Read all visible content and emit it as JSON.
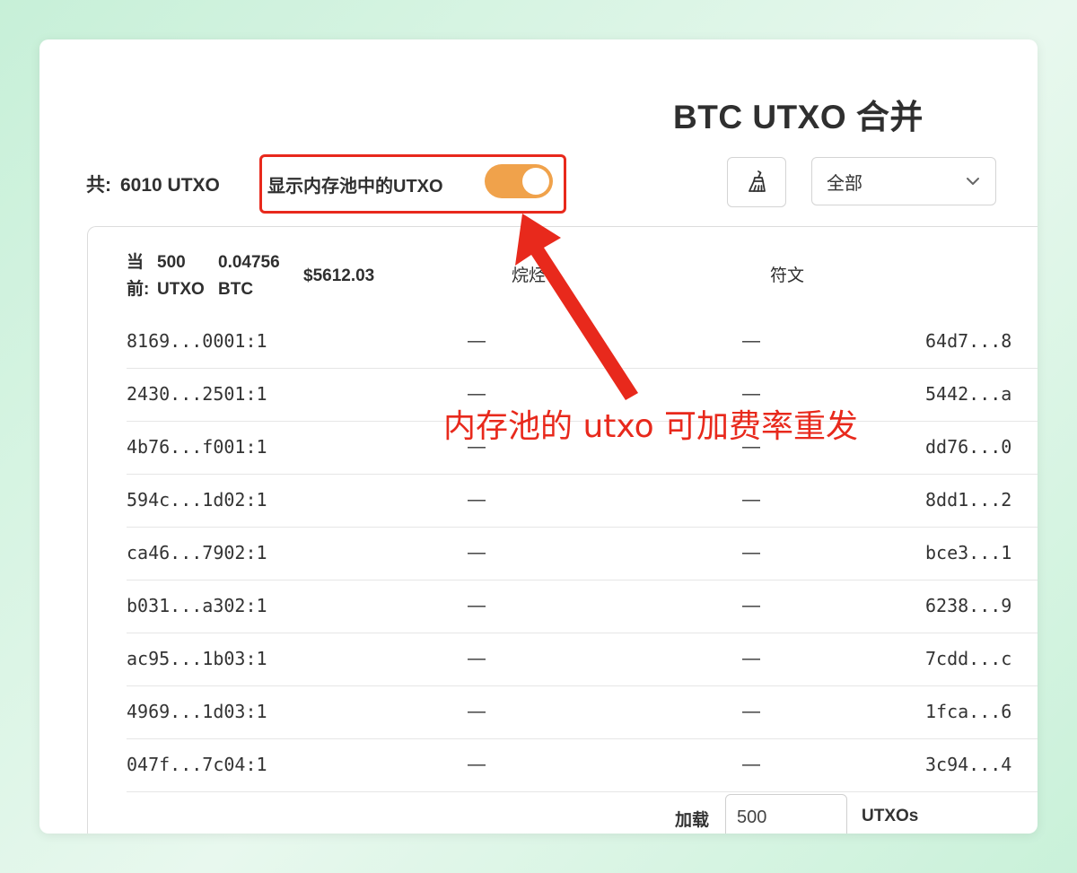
{
  "title": "BTC UTXO 合并",
  "total": {
    "label": "共:",
    "value": "6010 UTXO"
  },
  "mempool_toggle": {
    "label": "显示内存池中的UTXO",
    "on": true,
    "color": "#f0a24b"
  },
  "filter_select": {
    "value": "全部"
  },
  "table": {
    "header": {
      "current_label_1": "当",
      "current_label_2": "前:",
      "count_num": "500",
      "count_unit": "UTXO",
      "btc_num": "0.04756",
      "btc_unit": "BTC",
      "usd": "$5612.03",
      "col_burn": "烷烃",
      "col_rune": "符文"
    },
    "rows": [
      {
        "id": "8169...0001:1",
        "burn": "—",
        "rune": "—",
        "addr": "64d7...8"
      },
      {
        "id": "2430...2501:1",
        "burn": "—",
        "rune": "—",
        "addr": "5442...a"
      },
      {
        "id": "4b76...f001:1",
        "burn": "—",
        "rune": "—",
        "addr": "dd76...0"
      },
      {
        "id": "594c...1d02:1",
        "burn": "—",
        "rune": "—",
        "addr": "8dd1...2"
      },
      {
        "id": "ca46...7902:1",
        "burn": "—",
        "rune": "—",
        "addr": "bce3...1"
      },
      {
        "id": "b031...a302:1",
        "burn": "—",
        "rune": "—",
        "addr": "6238...9"
      },
      {
        "id": "ac95...1b03:1",
        "burn": "—",
        "rune": "—",
        "addr": "7cdd...c"
      },
      {
        "id": "4969...1d03:1",
        "burn": "—",
        "rune": "—",
        "addr": "1fca...6"
      },
      {
        "id": "047f...7c04:1",
        "burn": "—",
        "rune": "—",
        "addr": "3c94...4"
      }
    ],
    "load": {
      "label": "加载",
      "value": "500",
      "unit": "UTXOs"
    }
  },
  "annotation": {
    "text": "内存池的 utxo 可加费率重发",
    "color": "#e8291c"
  },
  "icons": {
    "clean": "broom-icon",
    "dropdown": "chevron-down-icon"
  }
}
